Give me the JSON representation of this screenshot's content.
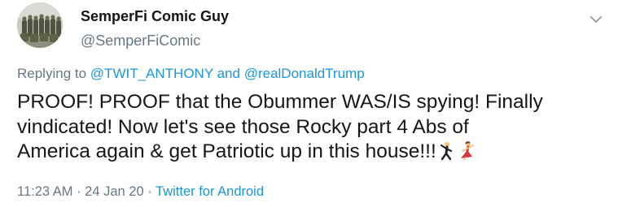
{
  "tweet": {
    "author": {
      "display_name": "SemperFi Comic Guy",
      "handle": "@SemperFiComic"
    },
    "reply": {
      "prefix": "Replying to",
      "mention_1": "@TWIT_ANTHONY",
      "conjunction": "and",
      "mention_2": "@realDonaldTrump"
    },
    "text_lines": [
      "PROOF! PROOF that the Obummer WAS/IS spying! Finally",
      "vindicated! Now let's see those Rocky part 4 Abs of",
      "America again & get Patriotic up in this house!!!"
    ],
    "emojis": [
      "man-dancing-icon",
      "woman-dancing-icon"
    ],
    "meta": {
      "time": "11:23 AM",
      "separator_1": " · ",
      "date": "24 Jan 20",
      "separator_2": " · ",
      "source": "Twitter for Android"
    }
  },
  "colors": {
    "text": "#14171a",
    "secondary": "#657786",
    "link": "#1b95e0"
  }
}
